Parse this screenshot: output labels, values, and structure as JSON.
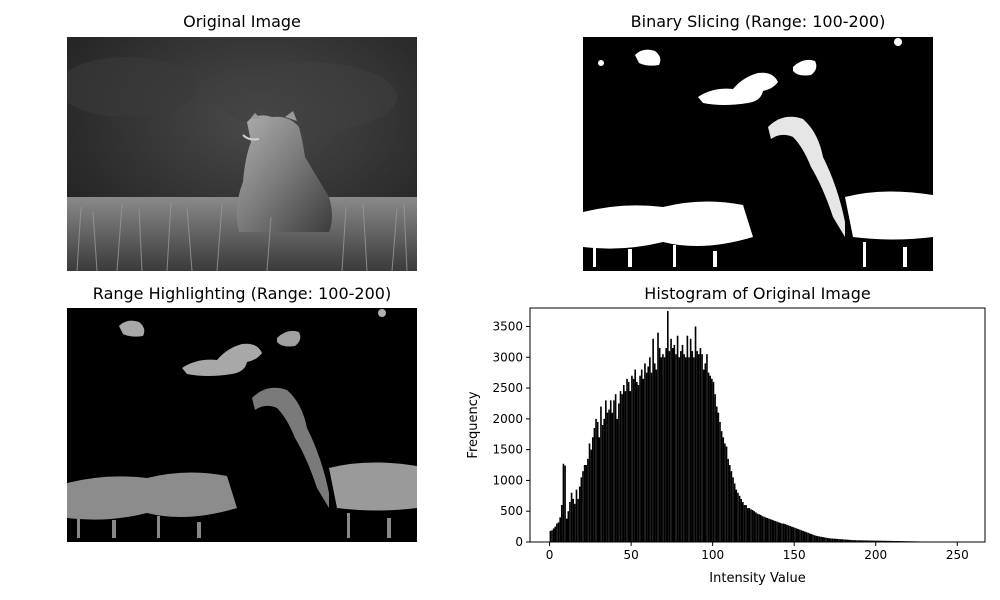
{
  "panels": {
    "original_title": "Original Image",
    "binary_title": "Binary Slicing (Range: 100-200)",
    "range_title": "Range Highlighting (Range: 100-200)",
    "histogram_title": "Histogram of Original Image"
  },
  "chart_data": {
    "type": "bar",
    "title": "Histogram of Original Image",
    "xlabel": "Intensity Value",
    "ylabel": "Frequency",
    "xlim": [
      -12,
      267
    ],
    "ylim": [
      0,
      3800
    ],
    "xticks": [
      0,
      50,
      100,
      150,
      200,
      250
    ],
    "yticks": [
      0,
      500,
      1000,
      1500,
      2000,
      2500,
      3000,
      3500
    ],
    "grid": false,
    "bar_color": "#000000",
    "x": [
      0,
      1,
      2,
      3,
      4,
      5,
      6,
      7,
      8,
      9,
      10,
      11,
      12,
      13,
      14,
      15,
      16,
      17,
      18,
      19,
      20,
      21,
      22,
      23,
      24,
      25,
      26,
      27,
      28,
      29,
      30,
      31,
      32,
      33,
      34,
      35,
      36,
      37,
      38,
      39,
      40,
      41,
      42,
      43,
      44,
      45,
      46,
      47,
      48,
      49,
      50,
      51,
      52,
      53,
      54,
      55,
      56,
      57,
      58,
      59,
      60,
      61,
      62,
      63,
      64,
      65,
      66,
      67,
      68,
      69,
      70,
      71,
      72,
      73,
      74,
      75,
      76,
      77,
      78,
      79,
      80,
      81,
      82,
      83,
      84,
      85,
      86,
      87,
      88,
      89,
      90,
      91,
      92,
      93,
      94,
      95,
      96,
      97,
      98,
      99,
      100,
      101,
      102,
      103,
      104,
      105,
      106,
      107,
      108,
      109,
      110,
      111,
      112,
      113,
      114,
      115,
      116,
      117,
      118,
      119,
      120,
      121,
      122,
      123,
      124,
      125,
      126,
      127,
      128,
      129,
      130,
      131,
      132,
      133,
      134,
      135,
      136,
      137,
      138,
      139,
      140,
      141,
      142,
      143,
      144,
      145,
      146,
      147,
      148,
      149,
      150,
      151,
      152,
      153,
      154,
      155,
      156,
      157,
      158,
      159,
      160,
      161,
      162,
      163,
      164,
      165,
      166,
      167,
      168,
      169,
      170,
      171,
      172,
      173,
      174,
      175,
      176,
      177,
      178,
      179,
      180,
      181,
      182,
      183,
      184,
      185,
      186,
      187,
      188,
      189,
      190,
      191,
      192,
      193,
      194,
      195,
      196,
      197,
      198,
      199,
      200,
      201,
      202,
      203,
      204,
      205,
      206,
      207,
      208,
      209,
      210,
      211,
      212,
      213,
      214,
      215,
      216,
      217,
      218,
      219,
      220,
      221,
      222,
      223,
      224,
      225,
      226,
      227,
      228,
      229,
      230,
      231,
      232,
      233,
      234,
      235,
      236,
      237,
      238,
      239,
      240,
      241,
      242,
      243,
      244,
      245,
      246,
      247,
      248,
      249,
      250,
      251,
      252,
      253,
      254,
      255
    ],
    "values": [
      180,
      190,
      220,
      250,
      300,
      320,
      400,
      600,
      1270,
      1240,
      380,
      500,
      650,
      800,
      700,
      620,
      850,
      700,
      900,
      1050,
      1150,
      1250,
      1250,
      1350,
      1600,
      1500,
      1700,
      1850,
      2000,
      1950,
      1700,
      2200,
      1900,
      2000,
      2300,
      2100,
      2150,
      2300,
      2100,
      2300,
      2400,
      2000,
      2250,
      2450,
      2400,
      2550,
      2450,
      2650,
      2600,
      2450,
      2700,
      2650,
      2800,
      2600,
      2550,
      2700,
      2800,
      2650,
      2900,
      2750,
      2850,
      3000,
      2750,
      3300,
      2900,
      2800,
      3400,
      3150,
      3000,
      3050,
      3000,
      3150,
      3750,
      3100,
      3300,
      3150,
      3200,
      3050,
      3350,
      3000,
      3100,
      3200,
      3050,
      3000,
      3350,
      3000,
      3300,
      3100,
      3000,
      3500,
      3100,
      3050,
      3150,
      3050,
      2800,
      2900,
      3050,
      2750,
      2700,
      2650,
      2600,
      2400,
      2200,
      2100,
      1950,
      1800,
      1700,
      1600,
      1550,
      1350,
      1250,
      1150,
      1050,
      950,
      850,
      800,
      750,
      700,
      650,
      600,
      600,
      550,
      550,
      530,
      520,
      500,
      480,
      460,
      450,
      440,
      420,
      410,
      400,
      390,
      380,
      370,
      360,
      350,
      340,
      330,
      320,
      310,
      300,
      300,
      290,
      280,
      270,
      260,
      250,
      240,
      230,
      220,
      210,
      200,
      190,
      180,
      170,
      160,
      150,
      140,
      130,
      120,
      110,
      100,
      95,
      90,
      85,
      80,
      75,
      70,
      65,
      60,
      58,
      56,
      54,
      52,
      50,
      48,
      46,
      44,
      42,
      40,
      38,
      36,
      34,
      32,
      30,
      30,
      28,
      28,
      27,
      27,
      26,
      26,
      25,
      25,
      24,
      24,
      23,
      23,
      22,
      22,
      21,
      21,
      20,
      20,
      19,
      19,
      18,
      18,
      17,
      17,
      16,
      16,
      15,
      15,
      14,
      14,
      13,
      13,
      12,
      12,
      11,
      11,
      10,
      10,
      9,
      9,
      8,
      8,
      7,
      7,
      6,
      6,
      5,
      5,
      5,
      5,
      4,
      4,
      4,
      4,
      3,
      3,
      3,
      3,
      2,
      2,
      2,
      2,
      1,
      1,
      1,
      1
    ]
  }
}
